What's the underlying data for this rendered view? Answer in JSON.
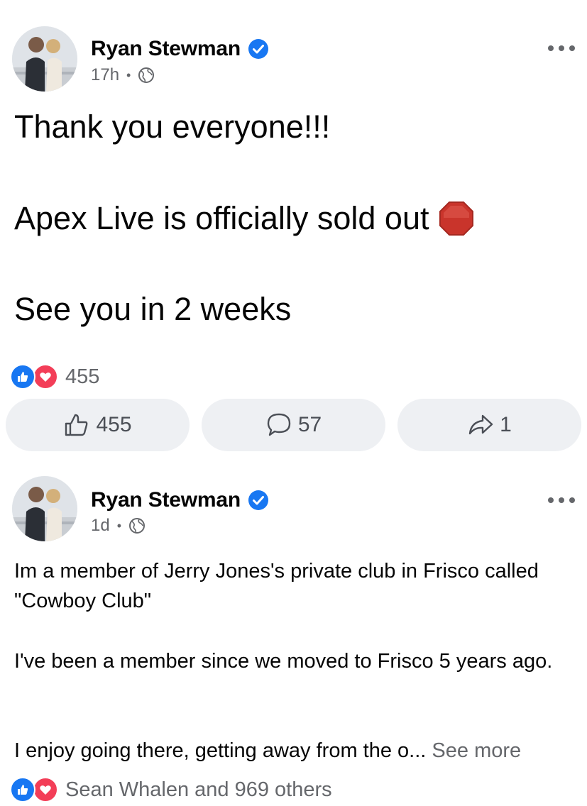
{
  "posts": [
    {
      "author": "Ryan Stewman",
      "time": "17h",
      "text_lines": [
        "Thank you everyone!!!",
        "Apex Live is officially sold out",
        "See you in 2 weeks"
      ],
      "reaction_summary": "455",
      "actions": {
        "like_count": "455",
        "comment_count": "57",
        "share_count": "1"
      },
      "emoji": "stop-sign"
    },
    {
      "author": "Ryan Stewman",
      "time": "1d",
      "paragraphs": [
        "Im a member of Jerry Jones's private club in Frisco called \"Cowboy Club\"",
        "I've been a member since we moved to Frisco 5 years ago.",
        "I enjoy going there, getting away from the o..."
      ],
      "see_more": "See more",
      "reaction_summary": "Sean Whalen and 969 others"
    }
  ],
  "colors": {
    "verified": "#1877f2",
    "like": "#1877f2",
    "love": "#f33e58",
    "meta_text": "#65676b",
    "action_bg": "#eef0f3"
  },
  "icons": [
    "avatar",
    "verified-icon",
    "globe-icon",
    "more-icon",
    "stop-sign-icon",
    "like-reaction-icon",
    "love-reaction-icon",
    "thumbs-up-icon",
    "comment-icon",
    "share-icon"
  ]
}
